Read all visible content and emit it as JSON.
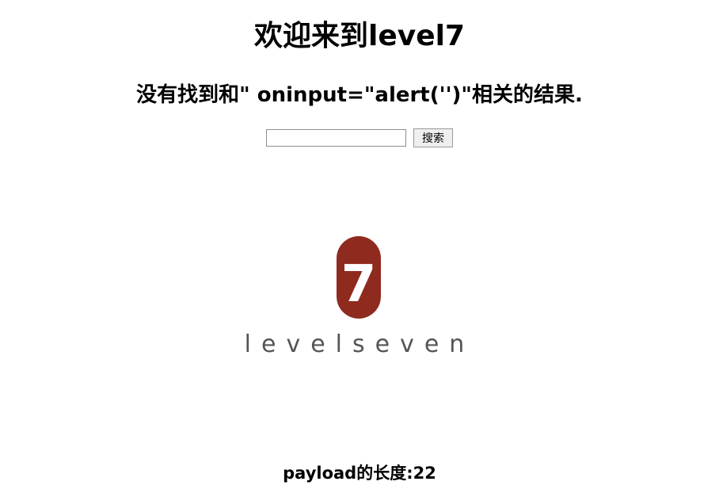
{
  "header": {
    "title": "欢迎来到level7"
  },
  "result": {
    "message": "没有找到和\" oninput=\"alert('')\"相关的结果."
  },
  "search": {
    "input_value": "",
    "button_label": "搜索"
  },
  "logo": {
    "badge_number": "7",
    "wordmark": "levelseven",
    "badge_color": "#8f2a1f",
    "wordmark_color": "#555555"
  },
  "footer": {
    "payload_length": "payload的长度:22"
  }
}
